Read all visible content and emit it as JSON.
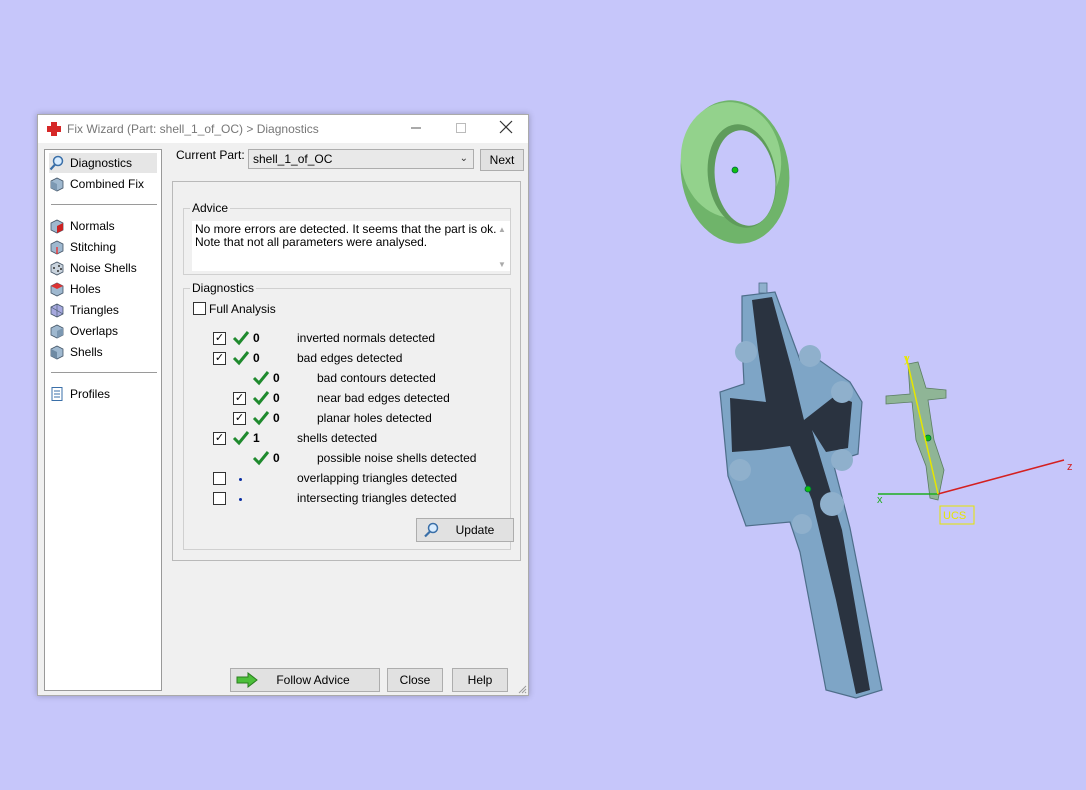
{
  "window": {
    "title": "Fix Wizard (Part: shell_1_of_OC) > Diagnostics",
    "minimize_icon": "minimize-icon",
    "maximize_icon": "maximize-icon",
    "close_icon": "close-icon"
  },
  "nav": {
    "items": [
      {
        "label": "Diagnostics",
        "icon": "magnifier-icon",
        "selected": true
      },
      {
        "label": "Combined Fix",
        "icon": "cube-icon"
      },
      {
        "label": "Normals",
        "icon": "normals-cube-icon"
      },
      {
        "label": "Stitching",
        "icon": "stitching-cube-icon"
      },
      {
        "label": "Noise Shells",
        "icon": "noise-shells-cube-icon"
      },
      {
        "label": "Holes",
        "icon": "holes-cube-icon"
      },
      {
        "label": "Triangles",
        "icon": "triangles-cube-icon"
      },
      {
        "label": "Overlaps",
        "icon": "overlaps-cube-icon"
      },
      {
        "label": "Shells",
        "icon": "shells-cube-icon"
      },
      {
        "label": "Profiles",
        "icon": "document-icon"
      }
    ]
  },
  "current_part": {
    "label": "Current Part:",
    "value": "shell_1_of_OC",
    "next_label": "Next"
  },
  "advice": {
    "title": "Advice",
    "line1": "No more errors are detected. It seems that the part is ok.",
    "line2": "Note that not all parameters were analysed."
  },
  "diagnostics": {
    "title": "Diagnostics",
    "full_analysis_label": "Full Analysis",
    "full_analysis_checked": false,
    "rows": [
      {
        "checked": true,
        "status": "ok",
        "count": "0",
        "label": "inverted normals detected"
      },
      {
        "checked": true,
        "status": "ok",
        "count": "0",
        "label": "bad edges detected"
      },
      {
        "status": "ok",
        "count": "0",
        "label": "bad contours detected"
      },
      {
        "checked": true,
        "status": "ok",
        "count": "0",
        "label": "near bad edges detected"
      },
      {
        "checked": true,
        "status": "ok",
        "count": "0",
        "label": "planar holes detected"
      },
      {
        "checked": true,
        "status": "ok",
        "count": "1",
        "label": "shells detected"
      },
      {
        "status": "ok",
        "count": "0",
        "label": "possible noise shells detected"
      },
      {
        "checked": false,
        "status": "pending",
        "count": "",
        "label": "overlapping triangles detected"
      },
      {
        "checked": false,
        "status": "pending",
        "count": "",
        "label": "intersecting triangles detected"
      }
    ],
    "update_label": "Update"
  },
  "buttons": {
    "follow_advice": "Follow Advice",
    "close": "Close",
    "help": "Help"
  },
  "viewport": {
    "axis_x": "x",
    "axis_y": "y",
    "axis_z": "z",
    "ucs_label": "UCS",
    "colors": {
      "background": "#c6c6fa",
      "ring": "#7fc47a",
      "cross": "#7ea5c6",
      "figure": "#8fb596",
      "axis_x": "#1fae1f",
      "axis_z": "#d42020",
      "axis_y": "#e6e600"
    }
  }
}
